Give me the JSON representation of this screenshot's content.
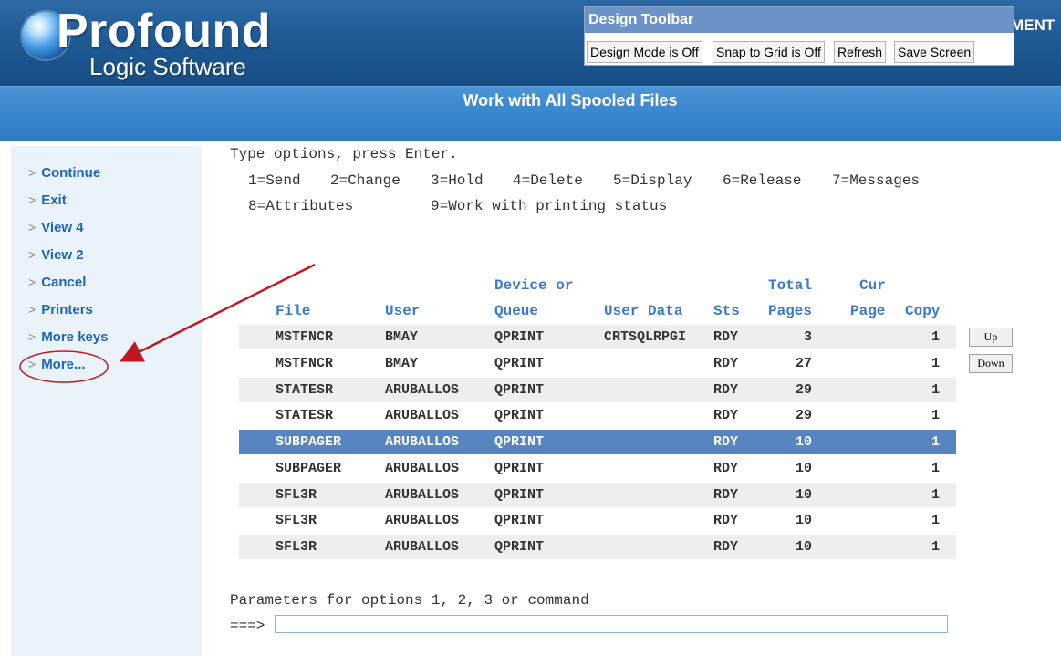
{
  "header": {
    "logo_main": "Profound",
    "logo_sub": "Logic Software",
    "right_text": "MENT",
    "page_title": "Work with All Spooled Files"
  },
  "toolbar": {
    "title": "Design Toolbar",
    "buttons": [
      "Design Mode is Off",
      "Snap to Grid is Off",
      "Refresh",
      "Save Screen"
    ]
  },
  "sidebar": {
    "items": [
      "Continue",
      "Exit",
      "View 4",
      "View 2",
      "Cancel",
      "Printers",
      "More keys",
      "More..."
    ]
  },
  "instructions": {
    "line1": "Type options, press Enter.",
    "options_row1": [
      "1=Send",
      "2=Change",
      "3=Hold",
      "4=Delete",
      "5=Display",
      "6=Release",
      "7=Messages"
    ],
    "options_row2": [
      "8=Attributes",
      "9=Work with printing status"
    ]
  },
  "table": {
    "headers_top": [
      "Device or",
      "Total",
      "Cur"
    ],
    "headers": [
      "File",
      "User",
      "Queue",
      "User Data",
      "Sts",
      "Pages",
      "Page",
      "Copy"
    ],
    "rows": [
      [
        "MSTFNCR",
        "BMAY",
        "QPRINT",
        "CRTSQLRPGI",
        "RDY",
        "3",
        "",
        "1"
      ],
      [
        "MSTFNCR",
        "BMAY",
        "QPRINT",
        "",
        "RDY",
        "27",
        "",
        "1"
      ],
      [
        "STATESR",
        "ARUBALLOS",
        "QPRINT",
        "",
        "RDY",
        "29",
        "",
        "1"
      ],
      [
        "STATESR",
        "ARUBALLOS",
        "QPRINT",
        "",
        "RDY",
        "29",
        "",
        "1"
      ],
      [
        "SUBPAGER",
        "ARUBALLOS",
        "QPRINT",
        "",
        "RDY",
        "10",
        "",
        "1"
      ],
      [
        "SUBPAGER",
        "ARUBALLOS",
        "QPRINT",
        "",
        "RDY",
        "10",
        "",
        "1"
      ],
      [
        "SFL3R",
        "ARUBALLOS",
        "QPRINT",
        "",
        "RDY",
        "10",
        "",
        "1"
      ],
      [
        "SFL3R",
        "ARUBALLOS",
        "QPRINT",
        "",
        "RDY",
        "10",
        "",
        "1"
      ],
      [
        "SFL3R",
        "ARUBALLOS",
        "QPRINT",
        "",
        "RDY",
        "10",
        "",
        "1"
      ]
    ],
    "selected_row": 4
  },
  "scroll": {
    "up": "Up",
    "down": "Down"
  },
  "command": {
    "label": "Parameters for options 1, 2, 3 or command",
    "prompt": "===>",
    "value": ""
  },
  "colors": {
    "header_bg": "#1f5a95",
    "subheader_bg": "#3a86cc",
    "sidebar_bg": "#eaf2fa",
    "link": "#1f66b3",
    "column_header": "#3b7ad1",
    "selected_row": "#5685c2",
    "annotation": "#c0181e"
  }
}
